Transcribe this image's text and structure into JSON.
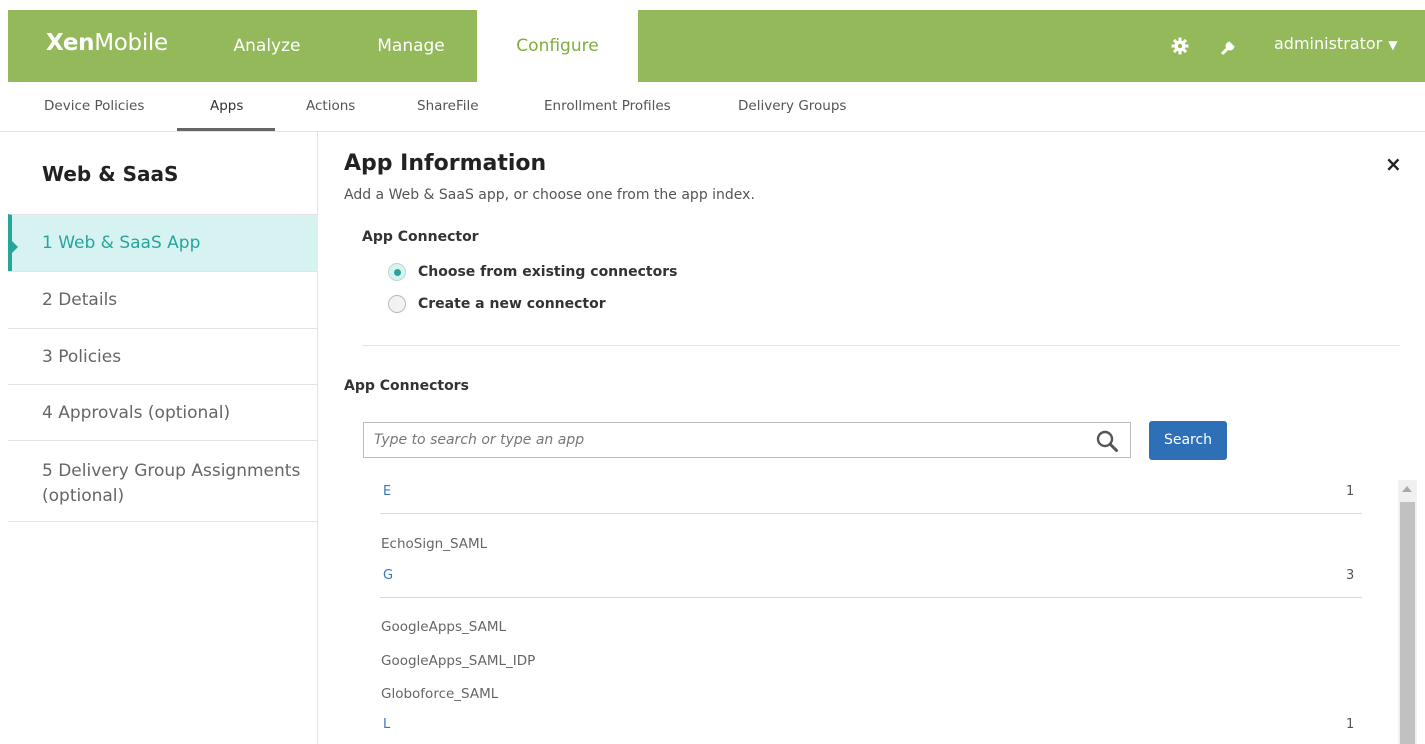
{
  "header": {
    "logo_bold": "Xen",
    "logo_light": "Mobile",
    "tabs": [
      {
        "label": "Analyze",
        "active": false
      },
      {
        "label": "Manage",
        "active": false
      },
      {
        "label": "Configure",
        "active": true
      }
    ],
    "settings_icon": "gear-icon",
    "tools_icon": "wrench-icon",
    "user": "administrator",
    "brand_color": "#93b95a"
  },
  "subnav": {
    "items": [
      {
        "label": "Device Policies"
      },
      {
        "label": "Apps",
        "active": true
      },
      {
        "label": "Actions"
      },
      {
        "label": "ShareFile"
      },
      {
        "label": "Enrollment Profiles"
      },
      {
        "label": "Delivery Groups"
      }
    ]
  },
  "sidebar": {
    "title": "Web & SaaS",
    "steps": [
      {
        "label": "1  Web & SaaS App",
        "active": true
      },
      {
        "label": "2  Details"
      },
      {
        "label": "3  Policies"
      },
      {
        "label": "4  Approvals (optional)"
      },
      {
        "label": "5  Delivery Group Assignments (optional)"
      }
    ],
    "accent_color": "#27a59b"
  },
  "main": {
    "title": "App Information",
    "subtitle": "Add a Web & SaaS app, or choose one from the app index.",
    "connector_label": "App Connector",
    "options": [
      {
        "label": "Choose from existing connectors",
        "checked": true
      },
      {
        "label": "Create a new connector",
        "checked": false
      }
    ],
    "connectors_label": "App Connectors",
    "search": {
      "placeholder": "Type to search or type an app",
      "value": "",
      "button": "Search"
    },
    "groups": [
      {
        "letter": "E",
        "count": "1",
        "items": [
          "EchoSign_SAML"
        ]
      },
      {
        "letter": "G",
        "count": "3",
        "items": [
          "GoogleApps_SAML",
          "GoogleApps_SAML_IDP",
          "Globoforce_SAML"
        ]
      },
      {
        "letter": "L",
        "count": "1",
        "items": []
      }
    ],
    "close_label": "×"
  }
}
